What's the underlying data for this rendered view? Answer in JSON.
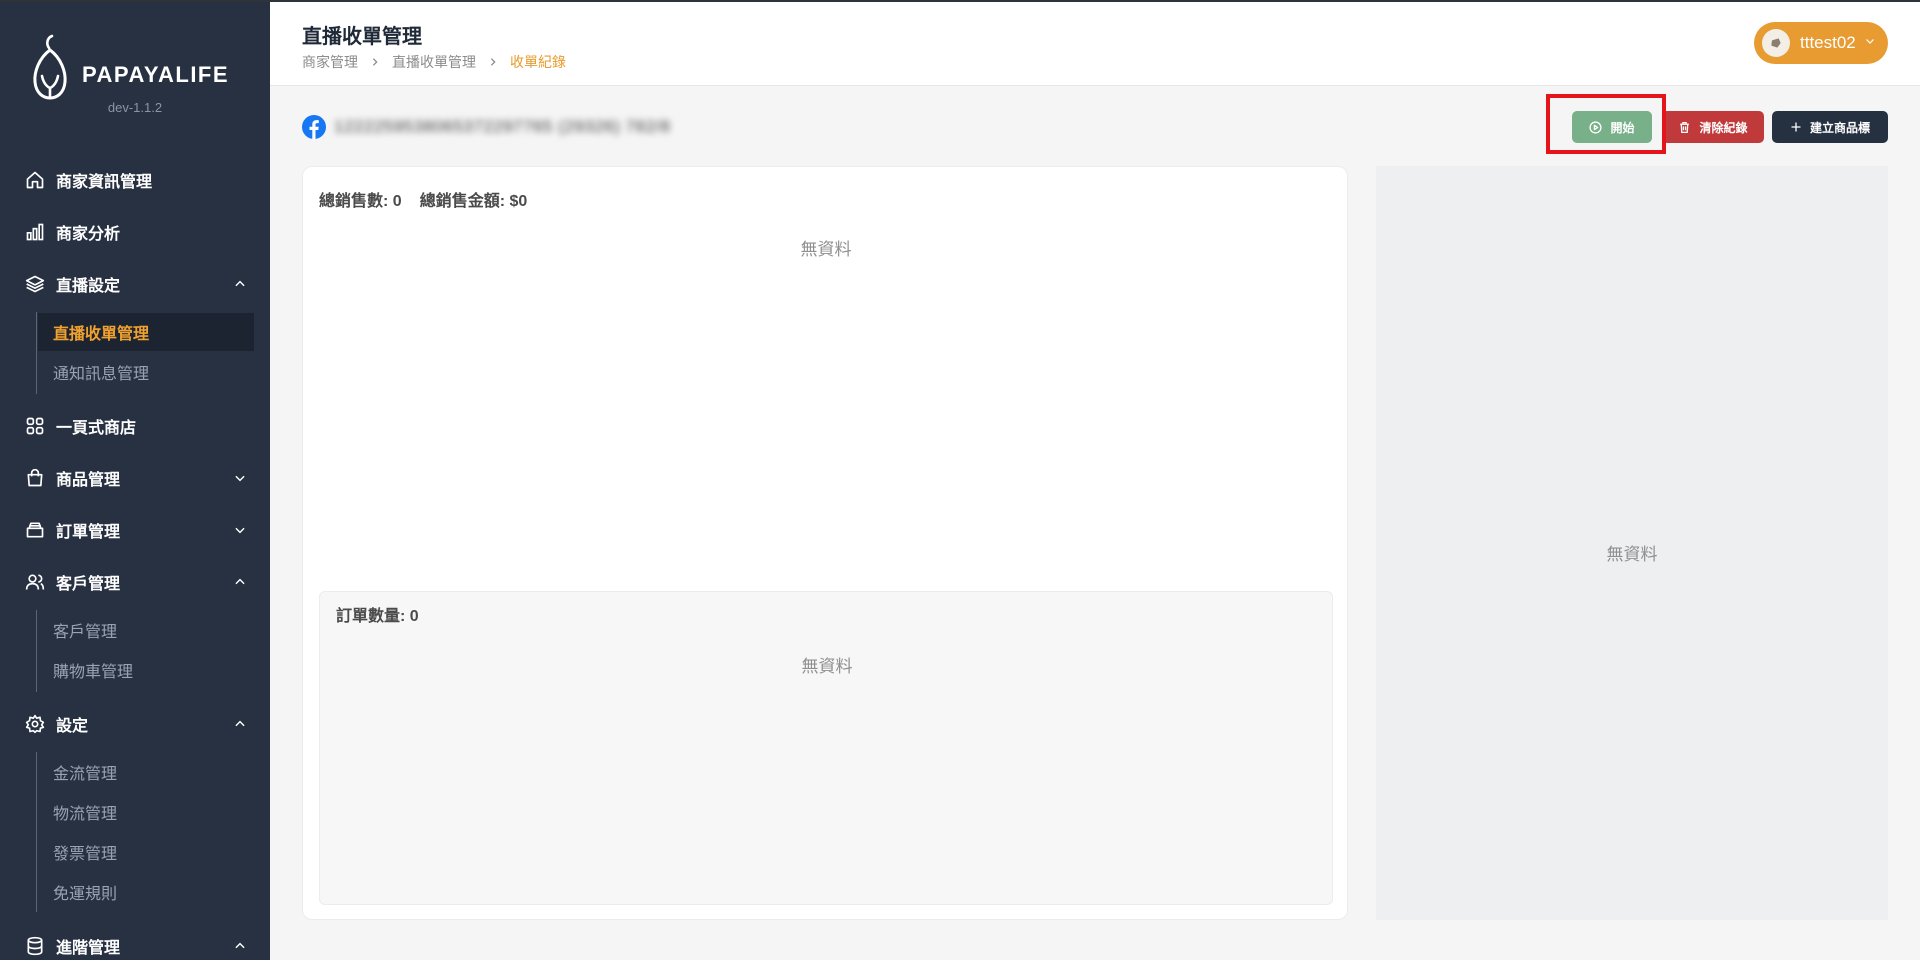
{
  "brand": {
    "name": "PAPAYALIFE",
    "version": "dev-1.1.2"
  },
  "sidebar": {
    "items": [
      {
        "label": "商家資訊管理",
        "icon": "home-icon"
      },
      {
        "label": "商家分析",
        "icon": "bar-chart-icon"
      },
      {
        "label": "直播設定",
        "icon": "layers-icon",
        "expanded": true,
        "children": [
          {
            "label": "直播收單管理",
            "active": true
          },
          {
            "label": "通知訊息管理"
          }
        ]
      },
      {
        "label": "一頁式商店",
        "icon": "grid-icon"
      },
      {
        "label": "商品管理",
        "icon": "shopping-bag-icon",
        "expanded": false
      },
      {
        "label": "訂單管理",
        "icon": "inbox-icon",
        "expanded": false
      },
      {
        "label": "客戶管理",
        "icon": "users-icon",
        "expanded": true,
        "children": [
          {
            "label": "客戶管理"
          },
          {
            "label": "購物車管理"
          }
        ]
      },
      {
        "label": "設定",
        "icon": "gear-icon",
        "expanded": true,
        "children": [
          {
            "label": "金流管理"
          },
          {
            "label": "物流管理"
          },
          {
            "label": "發票管理"
          },
          {
            "label": "免運規則"
          }
        ]
      },
      {
        "label": "進階管理",
        "icon": "database-icon",
        "expanded": true
      }
    ]
  },
  "header": {
    "title": "直播收單管理",
    "breadcrumb": [
      "商家管理",
      "直播收單管理",
      "收單紀錄"
    ]
  },
  "user": {
    "name": "tttest02"
  },
  "toolbar": {
    "stream_id": "1222259538065372297765 (29326) 782/8",
    "start_label": "開始",
    "clear_label": "清除紀錄",
    "create_label": "建立商品標"
  },
  "stats": {
    "total_sales_count": "總銷售數: 0",
    "total_sales_amount": "總銷售金額: $0"
  },
  "orders": {
    "count_label": "訂單數量: 0"
  },
  "empty": {
    "top": "無資料",
    "orders": "無資料",
    "right": "無資料"
  },
  "colors": {
    "sidebar_bg": "#283142",
    "accent": "#e79b31",
    "start_button": "#78b089",
    "clear_button": "#c0393b",
    "create_button": "#253041",
    "highlight": "#e5131a"
  }
}
